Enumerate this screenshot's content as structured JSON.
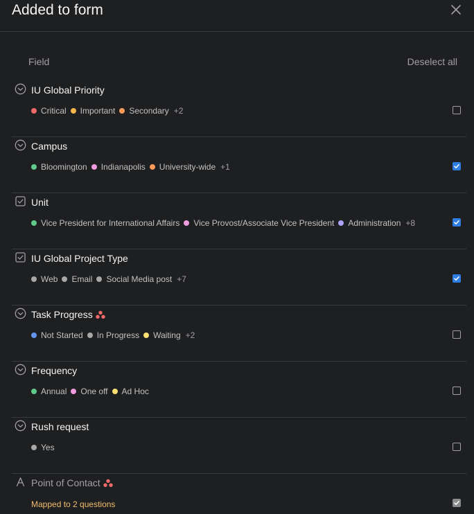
{
  "header": {
    "title": "Added to form"
  },
  "columns": {
    "field": "Field",
    "deselect_all": "Deselect all"
  },
  "colors": {
    "red": "#f06a6a",
    "yellow_orange": "#f8b54b",
    "orange": "#fd9a5b",
    "green": "#5fca8a",
    "pink": "#f19bdf",
    "purple": "#aaa3f9",
    "gray": "#a8a8a8",
    "blue": "#6495ed",
    "yellow": "#f8df72",
    "checkbox_blue": "#2f7de1",
    "mapped_text": "#f1bd6c"
  },
  "fields": [
    {
      "title": "IU Global Priority",
      "icon": "chevron-circle-icon",
      "checked": false,
      "options": [
        {
          "label": "Critical",
          "color": "#f06a6a"
        },
        {
          "label": "Important",
          "color": "#f8b54b"
        },
        {
          "label": "Secondary",
          "color": "#fd9a5b"
        }
      ],
      "more": "+2"
    },
    {
      "title": "Campus",
      "icon": "chevron-circle-icon",
      "checked": true,
      "options": [
        {
          "label": "Bloomington",
          "color": "#5fca8a"
        },
        {
          "label": "Indianapolis",
          "color": "#f19bdf"
        },
        {
          "label": "University-wide",
          "color": "#fd9a5b"
        }
      ],
      "more": "+1"
    },
    {
      "title": "Unit",
      "icon": "checkbox-square-icon",
      "checked": true,
      "options": [
        {
          "label": "Vice President for International Affairs",
          "color": "#5fca8a"
        },
        {
          "label": "Vice Provost/Associate Vice President",
          "color": "#f19bdf"
        },
        {
          "label": "Administration",
          "color": "#aaa3f9"
        }
      ],
      "more": "+8"
    },
    {
      "title": "IU Global Project Type",
      "icon": "checkbox-square-icon",
      "checked": true,
      "options": [
        {
          "label": "Web",
          "color": "#a8a8a8"
        },
        {
          "label": "Email",
          "color": "#a8a8a8"
        },
        {
          "label": "Social Media post",
          "color": "#a8a8a8"
        }
      ],
      "more": "+7"
    },
    {
      "title": "Task Progress",
      "icon": "chevron-circle-icon",
      "checked": false,
      "options": [
        {
          "label": "Not Started",
          "color": "#6495ed"
        },
        {
          "label": "In Progress",
          "color": "#a8a8a8"
        },
        {
          "label": "Waiting",
          "color": "#f8df72"
        }
      ],
      "more": "+2"
    },
    {
      "title": "Frequency",
      "icon": "chevron-circle-icon",
      "checked": false,
      "options": [
        {
          "label": "Annual",
          "color": "#5fca8a"
        },
        {
          "label": "One off",
          "color": "#f19bdf"
        },
        {
          "label": "Ad Hoc",
          "color": "#f8df72"
        }
      ],
      "more": ""
    },
    {
      "title": "Rush request",
      "icon": "chevron-circle-icon",
      "checked": false,
      "options": [
        {
          "label": "Yes",
          "color": "#a8a8a8"
        }
      ],
      "more": ""
    },
    {
      "title": "Point of Contact",
      "icon": "text-a-icon",
      "checked": true,
      "disabled": true,
      "mapped": "Mapped to 2 questions"
    }
  ]
}
